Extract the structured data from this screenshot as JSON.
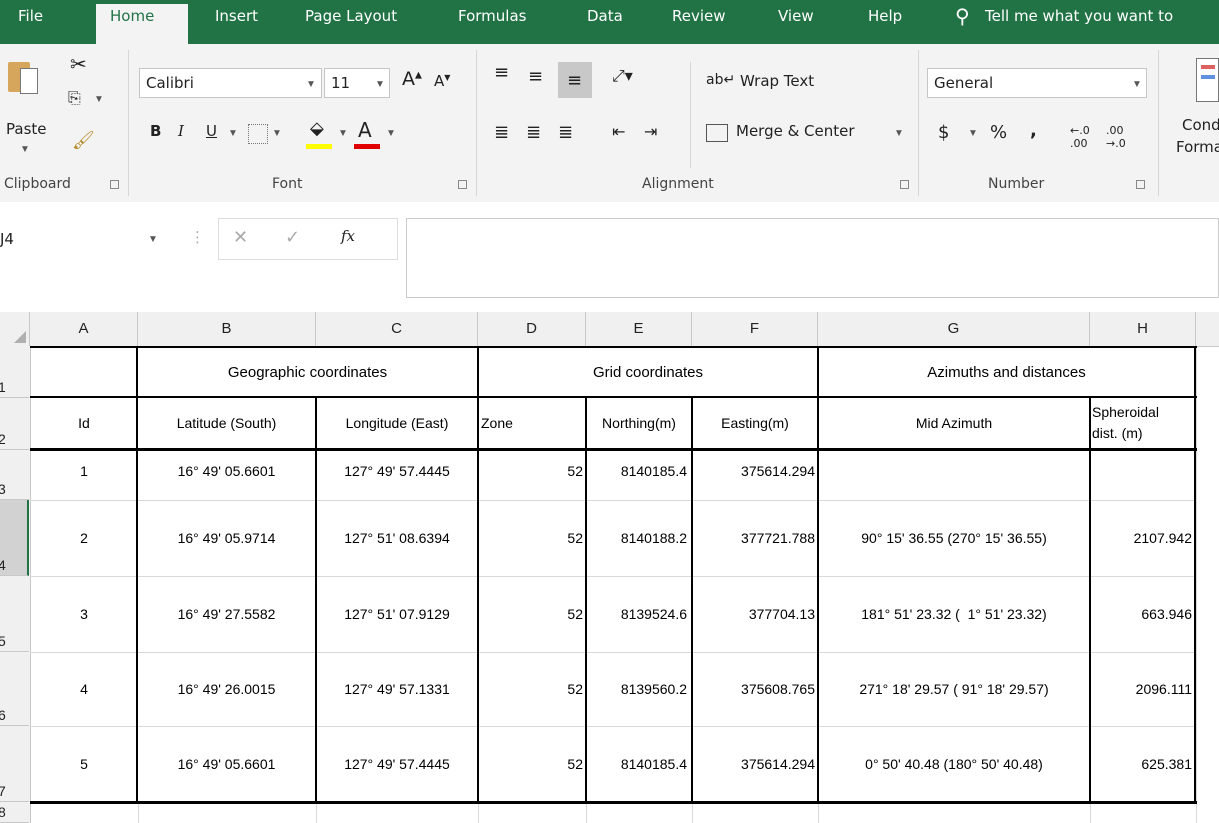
{
  "tabs": [
    "File",
    "Home",
    "Insert",
    "Page Layout",
    "Formulas",
    "Data",
    "Review",
    "View",
    "Help"
  ],
  "tell_me": "Tell me what you want to",
  "ribbon": {
    "paste": "Paste",
    "font_name": "Calibri",
    "font_size": "11",
    "bold": "B",
    "italic": "I",
    "underline": "U",
    "wrap_text": "Wrap Text",
    "merge_center": "Merge & Center",
    "number_format": "General",
    "currency": "$",
    "percent": "%",
    "comma": ",",
    "cond_format_1": "Cond",
    "cond_format_2": "Forma",
    "groups": {
      "clipboard": "Clipboard",
      "font": "Font",
      "alignment": "Alignment",
      "number": "Number"
    }
  },
  "name_box": "J4",
  "fx": "fx",
  "columns": [
    "A",
    "B",
    "C",
    "D",
    "E",
    "F",
    "G",
    "H"
  ],
  "rows": [
    "1",
    "2",
    "3",
    "4",
    "5",
    "6",
    "7",
    "8"
  ],
  "groups": {
    "geographic": "Geographic coordinates",
    "grid": "Grid coordinates",
    "azimuths": "Azimuths and distances"
  },
  "headers": {
    "id": "Id",
    "latitude": "Latitude (South)",
    "longitude": "Longitude (East)",
    "zone": "Zone",
    "northing": "Northing(m)",
    "easting": "Easting(m)",
    "mid_azimuth": "Mid Azimuth",
    "spheroidal_1": "Spheroidal",
    "spheroidal_2": "dist. (m)"
  },
  "data_rows": [
    {
      "id": "1",
      "lat": "16° 49' 05.6601",
      "lon": "127° 49' 57.4445",
      "zone": "52",
      "northing": "8140185.4",
      "easting": "375614.294",
      "azimuth": "",
      "dist": ""
    },
    {
      "id": "2",
      "lat": "16° 49' 05.9714",
      "lon": "127° 51' 08.6394",
      "zone": "52",
      "northing": "8140188.2",
      "easting": "377721.788",
      "azimuth": "90° 15' 36.55 (270° 15' 36.55)",
      "dist": "2107.942"
    },
    {
      "id": "3",
      "lat": "16° 49' 27.5582",
      "lon": "127° 51' 07.9129",
      "zone": "52",
      "northing": "8139524.6",
      "easting": "377704.13",
      "azimuth": "181° 51' 23.32 (  1° 51' 23.32)",
      "dist": "663.946"
    },
    {
      "id": "4",
      "lat": "16° 49' 26.0015",
      "lon": "127° 49' 57.1331",
      "zone": "52",
      "northing": "8139560.2",
      "easting": "375608.765",
      "azimuth": "271° 18' 29.57 ( 91° 18' 29.57)",
      "dist": "2096.111"
    },
    {
      "id": "5",
      "lat": "16° 49' 05.6601",
      "lon": "127° 49' 57.4445",
      "zone": "52",
      "northing": "8140185.4",
      "easting": "375614.294",
      "azimuth": "0° 50' 40.48 (180° 50' 40.48)",
      "dist": "625.381"
    }
  ]
}
